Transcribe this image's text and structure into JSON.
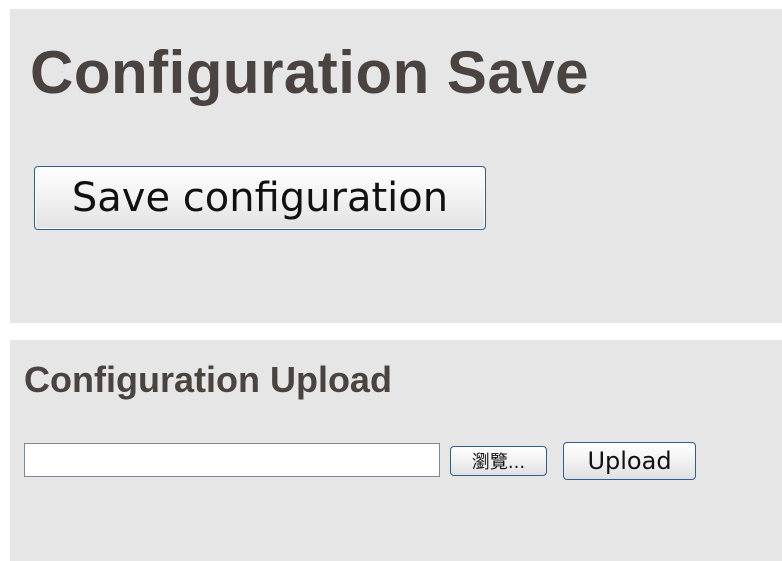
{
  "save_section": {
    "title": "Configuration Save",
    "button_label": "Save configuration"
  },
  "upload_section": {
    "title": "Configuration Upload",
    "file_input_value": "",
    "browse_label": "瀏覽...",
    "upload_label": "Upload"
  },
  "colors": {
    "panel_background": "#e6e6e6",
    "heading_text": "#4a4340",
    "button_border": "#2f5d8f"
  }
}
